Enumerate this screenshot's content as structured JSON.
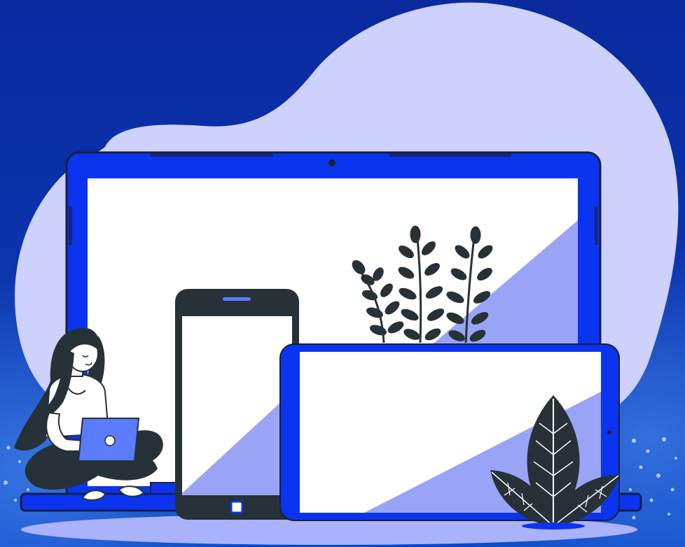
{
  "illustration": {
    "subject": "responsive-devices",
    "elements": [
      "laptop",
      "smartphone",
      "tablet",
      "person-with-laptop",
      "plants",
      "leaf-plant"
    ]
  },
  "colors": {
    "background_top": "#0a2a9e",
    "background_bottom": "#0b3fb8",
    "blob": "#cdd1fb",
    "device_blue": "#0b34f0",
    "device_dark": "#263238",
    "screen_white": "#ffffff",
    "screen_shade": "#9aa4f7",
    "floor": "#aab2fb",
    "plant_dark": "#263238"
  }
}
